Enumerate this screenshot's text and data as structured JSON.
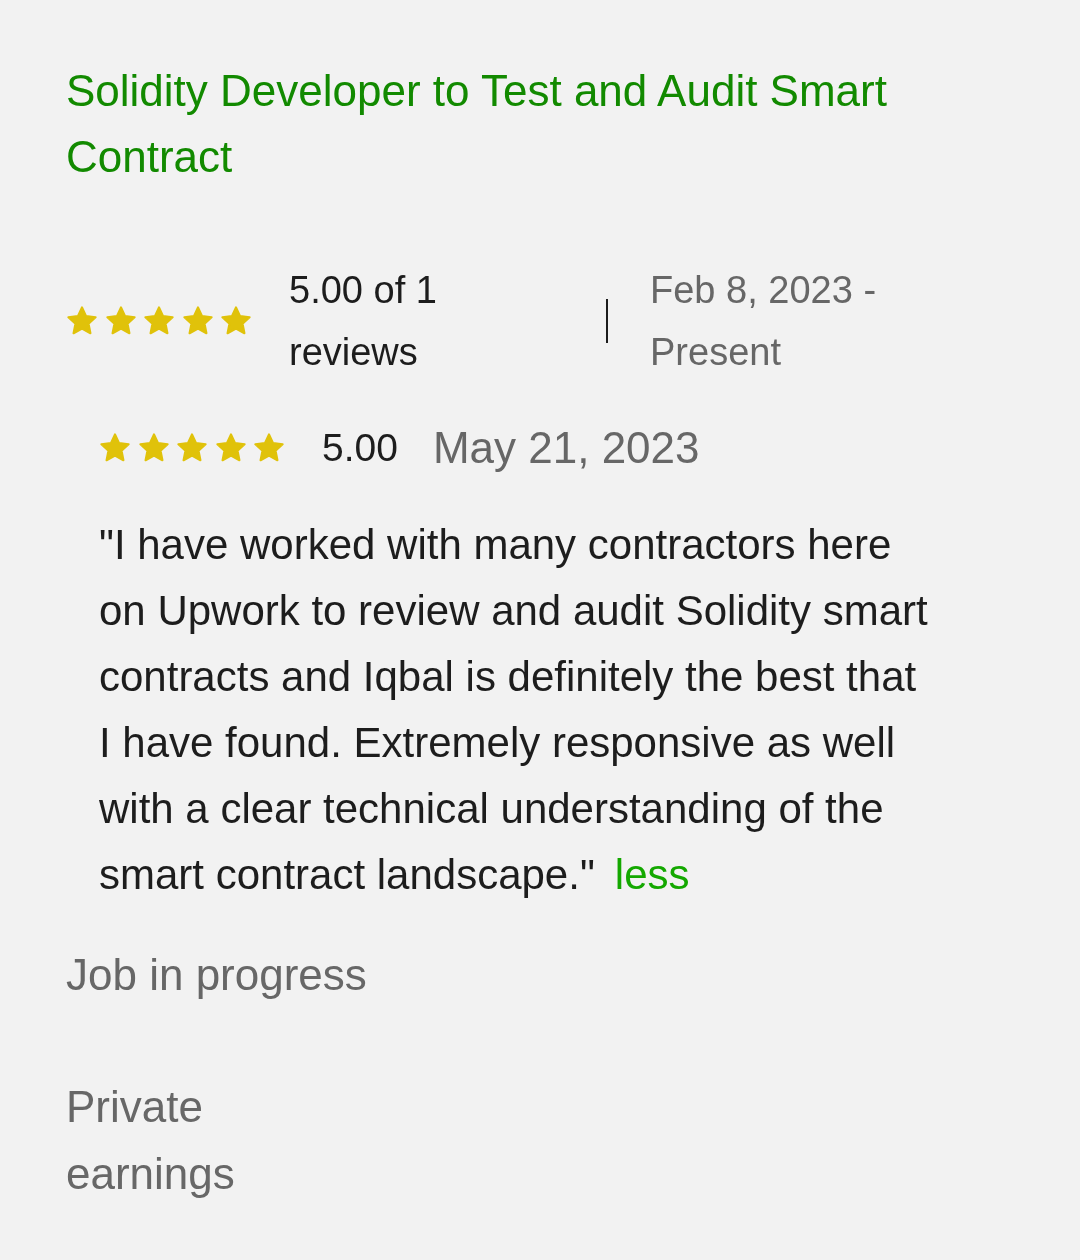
{
  "job": {
    "title": "Solidity Developer to Test and Audit Smart Contract",
    "stars": 5,
    "rating_summary": "5.00 of 1 reviews",
    "period": "Feb 8, 2023 - Present"
  },
  "review": {
    "stars": 5,
    "score": "5.00",
    "date": "May 21, 2023",
    "text": "\"I have worked with many contractors here on Upwork to review and audit Solidity smart contracts and Iqbal is definitely the best that I have found. Extremely responsive as well with a clear technical understanding of the smart contract landscape.\"",
    "toggle_link": "less"
  },
  "status": "Job in progress",
  "earnings": "Private earnings"
}
